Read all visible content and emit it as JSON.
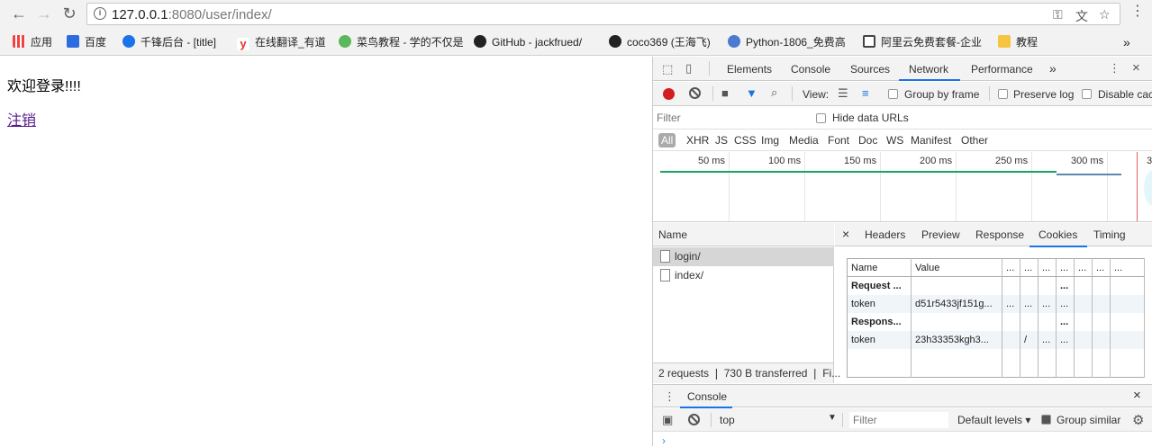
{
  "browser": {
    "url_host": "127.0.0.1",
    "url_rest": ":8080/user/index/",
    "bookmarks": [
      {
        "label": "应用",
        "color": "#e44",
        "icon": "apps-icon"
      },
      {
        "label": "百度",
        "color": "#2d6be0",
        "icon": "baidu-icon"
      },
      {
        "label": "千锋后台 - [title]",
        "color": "#1a73e8",
        "icon": "qianfeng-icon"
      },
      {
        "label": "在线翻译_有道",
        "color": "#e5332a",
        "icon": "youdao-icon"
      },
      {
        "label": "菜鸟教程 - 学的不仅是",
        "color": "#5bb75b",
        "icon": "runoob-icon"
      },
      {
        "label": "GitHub - jackfrued/",
        "color": "#222",
        "icon": "github-icon"
      },
      {
        "label": "coco369 (王海飞)",
        "color": "#222",
        "icon": "github-icon"
      },
      {
        "label": "Python-1806_免费高",
        "color": "#4a7bd0",
        "icon": "python-icon"
      },
      {
        "label": "阿里云免费套餐-企业",
        "color": "#444",
        "icon": "aliyun-icon"
      },
      {
        "label": "教程",
        "color": "#f5c542",
        "icon": "folder-icon"
      }
    ],
    "overflow": "»"
  },
  "page": {
    "welcome": "欢迎登录!!!!",
    "logout": "注销"
  },
  "devtools": {
    "tabs": [
      "Elements",
      "Console",
      "Sources",
      "Network",
      "Performance"
    ],
    "active_tab": "Network",
    "more": "»",
    "view_label": "View:",
    "group_by_frame": "Group by frame",
    "preserve_log": "Preserve log",
    "disable_cache": "Disable cac",
    "filter_placeholder": "Filter",
    "hide_data_urls": "Hide data URLs",
    "types": [
      "All",
      "XHR",
      "JS",
      "CSS",
      "Img",
      "Media",
      "Font",
      "Doc",
      "WS",
      "Manifest",
      "Other"
    ],
    "timeline_ticks": [
      "50 ms",
      "100 ms",
      "150 ms",
      "200 ms",
      "250 ms",
      "300 ms",
      "3"
    ],
    "requests_header": "Name",
    "requests": [
      "login/",
      "index/"
    ],
    "selected_request": "login/",
    "status": "2 requests ❘ 730 B transferred ❘ Fi...",
    "detail_close": "×",
    "detail_tabs": [
      "Headers",
      "Preview",
      "Response",
      "Cookies",
      "Timing"
    ],
    "detail_active": "Cookies",
    "cookies": {
      "headers": [
        "Name",
        "Value",
        "...",
        "...",
        "...",
        "...",
        "...",
        "...",
        "..."
      ],
      "rows": [
        {
          "cells": [
            "Request ...",
            "",
            "",
            "",
            "",
            "...",
            "",
            "",
            ""
          ],
          "bold": true
        },
        {
          "cells": [
            "token",
            "d51r5433jf151g...",
            "...",
            "...",
            "...",
            "...",
            "",
            "",
            ""
          ],
          "bold": false
        },
        {
          "cells": [
            "Respons...",
            "",
            "",
            "",
            "",
            "...",
            "",
            "",
            ""
          ],
          "bold": true
        },
        {
          "cells": [
            "token",
            "23h33353kgh3...",
            "",
            "/",
            "...",
            "...",
            "",
            "",
            ""
          ],
          "bold": false
        }
      ]
    },
    "drawer_tab": "Console",
    "drawer_close": "×",
    "console_context": "top",
    "console_filter_placeholder": "Filter",
    "default_levels": "Default levels ▾",
    "group_similar": "Group similar",
    "prompt": "›"
  }
}
